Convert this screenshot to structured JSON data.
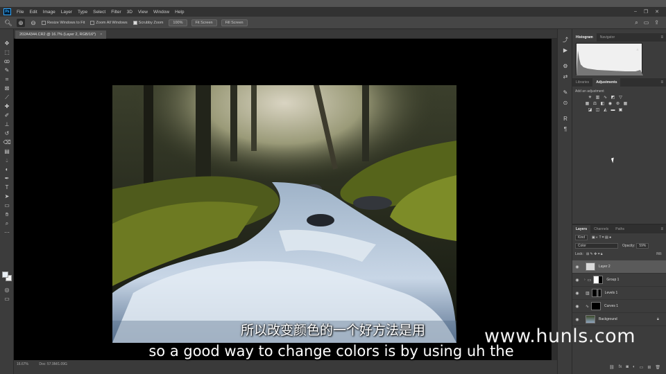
{
  "app": {
    "logo": "Ps"
  },
  "menu": [
    "File",
    "Edit",
    "Image",
    "Layer",
    "Type",
    "Select",
    "Filter",
    "3D",
    "View",
    "Window",
    "Help"
  ],
  "window_controls": [
    "minimize-icon",
    "restore-icon",
    "close-icon"
  ],
  "options_bar": {
    "resize_windows": "Resize Windows to Fit",
    "zoom_all": "Zoom All Windows",
    "scrubby_zoom": "Scrubby Zoom",
    "zoom_level": "100%",
    "fit_screen": "Fit Screen",
    "fill_screen": "Fill Screen"
  },
  "document": {
    "tab_title": "202A4344.CR2 @ 16.7% (Layer 2, RGB/16*)",
    "tab_close": "×",
    "status_zoom": "16.67%",
    "status_doc": "Doc: 57.9M/1.09G"
  },
  "panels": {
    "histogram_tabs": [
      "Histogram",
      "Navigator"
    ],
    "adjust_tabs": [
      "Libraries",
      "Adjustments"
    ],
    "adjust_title": "Add an adjustment",
    "layers_tabs": [
      "Layers",
      "Channels",
      "Paths"
    ],
    "kind_label": "Kind",
    "blend_mode": "Color",
    "opacity_label": "Opacity:",
    "opacity_value": "59%",
    "lock_label": "Lock:",
    "fill_label": "Fill:",
    "layers": [
      {
        "name": "Layer 2",
        "active": true
      },
      {
        "name": "Group 1",
        "active": false
      },
      {
        "name": "Levels 1",
        "active": false
      },
      {
        "name": "Curves 1",
        "active": false
      },
      {
        "name": "Background",
        "active": false
      }
    ]
  },
  "subtitles": {
    "chinese": "所以改变颜色的一个好方法是用",
    "english": "so a good way to change colors is by using uh the"
  },
  "watermark": "www.hunls.com"
}
